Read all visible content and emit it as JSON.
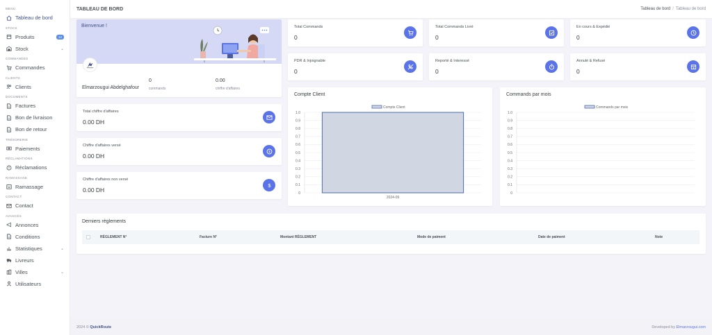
{
  "sidebar": {
    "sections": [
      {
        "label": "MENU",
        "items": [
          {
            "label": "Tableau de bord",
            "icon": "home-icon",
            "active": true
          }
        ]
      },
      {
        "label": "STOCK",
        "items": [
          {
            "label": "Produits",
            "icon": "box-icon",
            "badge": "12"
          },
          {
            "label": "Stock",
            "icon": "warehouse-icon",
            "chevron": true
          }
        ]
      },
      {
        "label": "COMMANDES",
        "items": [
          {
            "label": "Commandes",
            "icon": "cart-icon"
          }
        ]
      },
      {
        "label": "CLIENTS",
        "items": [
          {
            "label": "Clients",
            "icon": "users-icon"
          }
        ]
      },
      {
        "label": "DOCUMENTS",
        "items": [
          {
            "label": "Factures",
            "icon": "file-icon"
          },
          {
            "label": "Bon de livraison",
            "icon": "file-icon"
          },
          {
            "label": "Bon de retour",
            "icon": "file-icon"
          }
        ]
      },
      {
        "label": "TRÉSORERIE",
        "items": [
          {
            "label": "Paiements",
            "icon": "money-icon"
          }
        ]
      },
      {
        "label": "RÉCLAMATIONS",
        "items": [
          {
            "label": "Réclamations",
            "icon": "alert-icon"
          }
        ]
      },
      {
        "label": "RAMASSAGE",
        "items": [
          {
            "label": "Ramassage",
            "icon": "pickup-icon"
          }
        ]
      },
      {
        "label": "CONTACT",
        "items": [
          {
            "label": "Contact",
            "icon": "mail-icon"
          }
        ]
      },
      {
        "label": "AVANCÉS",
        "items": [
          {
            "label": "Annonces",
            "icon": "megaphone-icon"
          },
          {
            "label": "Conditions",
            "icon": "file-icon"
          },
          {
            "label": "Statistiques",
            "icon": "chart-icon",
            "chevron": true
          },
          {
            "label": "Livreurs",
            "icon": "truck-icon"
          },
          {
            "label": "Villes",
            "icon": "city-icon",
            "chevron": true
          },
          {
            "label": "Utilisateurs",
            "icon": "user-icon"
          }
        ]
      }
    ]
  },
  "topbar": {
    "title": "TABLEAU DE BORD",
    "crumb_parent": "Tableau de bord",
    "crumb_current": "Tableau de bord"
  },
  "welcome": {
    "greeting": "Bienvenue !",
    "user_name": "Elmarzougui Abdelghafour",
    "commands_value": "0",
    "commands_label": "commands",
    "revenue_value": "0.00",
    "revenue_label": "chiffre d'affaires"
  },
  "stats": [
    {
      "label": "Total Commands",
      "value": "0",
      "icon": "cart-icon"
    },
    {
      "label": "Total Commands Livré",
      "value": "0",
      "icon": "check-square-icon"
    },
    {
      "label": "En cours & Expédié",
      "value": "0",
      "icon": "clock-icon"
    },
    {
      "label": "PDR & Injoignable",
      "value": "0",
      "icon": "phone-off-icon"
    },
    {
      "label": "Reporté & Interessé",
      "value": "0",
      "icon": "timer-icon"
    },
    {
      "label": "Annulé & Refusé",
      "value": "0",
      "icon": "calendar-x-icon"
    }
  ],
  "finance": [
    {
      "label": "Total chiffre d'affaires",
      "value": "0.00 DH",
      "icon": "envelope-money-icon"
    },
    {
      "label": "Chiffre d'affaires versé",
      "value": "0.00 DH",
      "icon": "coin-icon"
    },
    {
      "label": "Chiffre d'affaires non versé",
      "value": "0.00 DH",
      "icon": "dollar-icon"
    }
  ],
  "colors": {
    "accent": "#405189",
    "icon_bg": "#5b73e8",
    "banner": "#d5d9f6",
    "bar_fill": "#d1d6e3",
    "bar_stroke": "#4a6bb5"
  },
  "chart_data": [
    {
      "type": "bar",
      "title": "Compte Client",
      "categories": [
        "2024-09"
      ],
      "series": [
        {
          "name": "Compte Client",
          "values": [
            1.0
          ]
        }
      ],
      "ylim": [
        0,
        1.0
      ],
      "yticks": [
        "0",
        "0.1",
        "0.2",
        "0.3",
        "0.4",
        "0.5",
        "0.6",
        "0.7",
        "0.8",
        "0.9",
        "1.0"
      ],
      "legend": "top-center",
      "grid": true
    },
    {
      "type": "bar",
      "title": "Commands par mois",
      "categories": [],
      "series": [
        {
          "name": "Commands par mois",
          "values": []
        }
      ],
      "ylim": [
        0,
        1.0
      ],
      "yticks": [
        "0",
        "0.1",
        "0.2",
        "0.3",
        "0.4",
        "0.5",
        "0.6",
        "0.7",
        "0.8",
        "0.9",
        "1.0"
      ],
      "legend": "top-center",
      "grid": true
    }
  ],
  "table": {
    "title": "Derniers règlements",
    "columns": [
      "RÈGLEMENT N°",
      "Facture N°",
      "Montant RÈGLEMENT",
      "Mode de paiment",
      "Date de paiment",
      "Note"
    ]
  },
  "footer": {
    "left_prefix": "2024 ©",
    "brand": "QuickRoute",
    "right_prefix": "Developed by",
    "dev_name": "Elmarzougui.com"
  }
}
